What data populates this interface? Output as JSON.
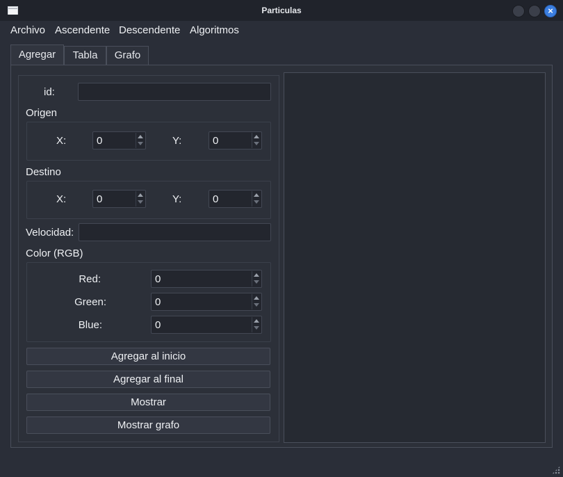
{
  "window": {
    "title": "Particulas"
  },
  "menubar": {
    "items": [
      "Archivo",
      "Ascendente",
      "Descendente",
      "Algoritmos"
    ]
  },
  "tabs": [
    {
      "label": "Agregar",
      "active": true
    },
    {
      "label": "Tabla",
      "active": false
    },
    {
      "label": "Grafo",
      "active": false
    }
  ],
  "form": {
    "id_label": "id:",
    "id_value": "",
    "origen": {
      "title": "Origen",
      "x_label": "X:",
      "x_value": "0",
      "y_label": "Y:",
      "y_value": "0"
    },
    "destino": {
      "title": "Destino",
      "x_label": "X:",
      "x_value": "0",
      "y_label": "Y:",
      "y_value": "0"
    },
    "velocidad_label": "Velocidad:",
    "velocidad_value": "",
    "color": {
      "title": "Color (RGB)",
      "red_label": "Red:",
      "red_value": "0",
      "green_label": "Green:",
      "green_value": "0",
      "blue_label": "Blue:",
      "blue_value": "0"
    }
  },
  "buttons": {
    "agregar_inicio": "Agregar al inicio",
    "agregar_final": "Agregar al final",
    "mostrar": "Mostrar",
    "mostrar_grafo": "Mostrar grafo"
  },
  "icons": {
    "app": "window-icon",
    "close": "close-icon",
    "grip": "resize-grip-icon"
  },
  "colors": {
    "accent": "#3b7ee0",
    "background": "#2a2e38"
  }
}
